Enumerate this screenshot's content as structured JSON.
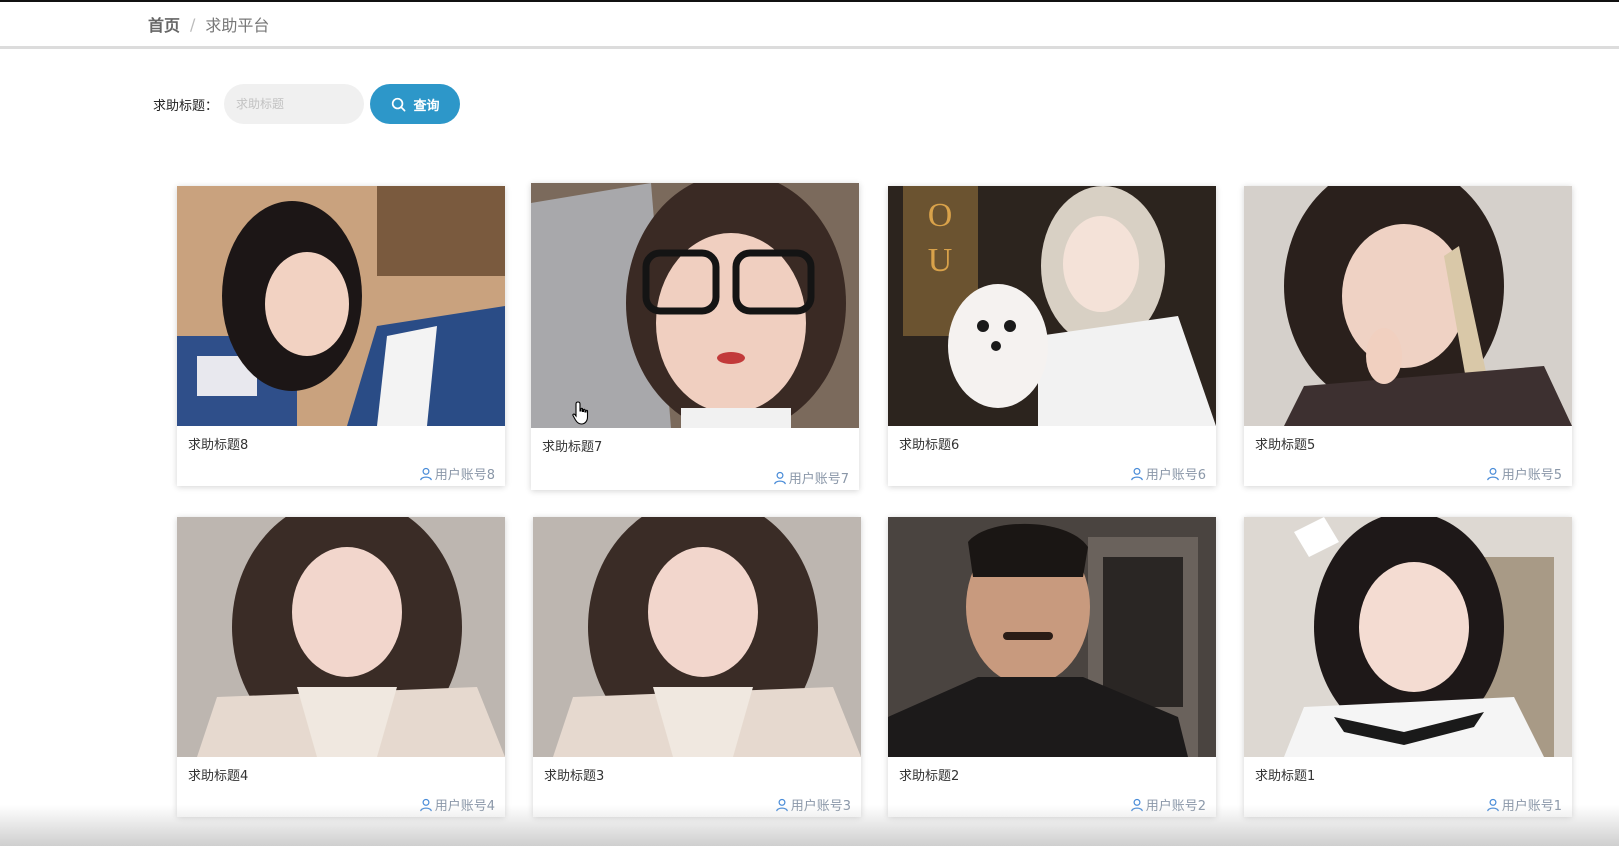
{
  "breadcrumb": {
    "home": "首页",
    "separator": "/",
    "current": "求助平台"
  },
  "search": {
    "label": "求助标题：",
    "placeholder": "求助标题",
    "button_label": "查询",
    "button_color": "#2d97c9"
  },
  "cards": [
    {
      "title": "求助标题8",
      "user": "用户账号8"
    },
    {
      "title": "求助标题7",
      "user": "用户账号7"
    },
    {
      "title": "求助标题6",
      "user": "用户账号6"
    },
    {
      "title": "求助标题5",
      "user": "用户账号5"
    },
    {
      "title": "求助标题4",
      "user": "用户账号4"
    },
    {
      "title": "求助标题3",
      "user": "用户账号3"
    },
    {
      "title": "求助标题2",
      "user": "用户账号2"
    },
    {
      "title": "求助标题1",
      "user": "用户账号1"
    }
  ],
  "icons": {
    "search": "search-icon",
    "user": "user-icon",
    "cursor": "hand-cursor-icon"
  }
}
